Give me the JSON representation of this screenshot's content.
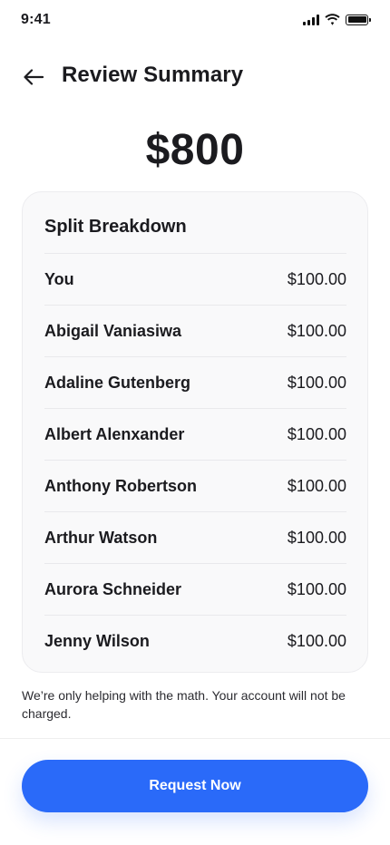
{
  "status_bar": {
    "time": "9:41"
  },
  "header": {
    "title": "Review Summary"
  },
  "total_amount": "$800",
  "breakdown": {
    "title": "Split Breakdown",
    "rows": [
      {
        "name": "You",
        "amount": "$100.00"
      },
      {
        "name": "Abigail Vaniasiwa",
        "amount": "$100.00"
      },
      {
        "name": "Adaline Gutenberg",
        "amount": "$100.00"
      },
      {
        "name": "Albert Alenxander",
        "amount": "$100.00"
      },
      {
        "name": "Anthony Robertson",
        "amount": "$100.00"
      },
      {
        "name": "Arthur Watson",
        "amount": "$100.00"
      },
      {
        "name": "Aurora Schneider",
        "amount": "$100.00"
      },
      {
        "name": "Jenny Wilson",
        "amount": "$100.00"
      }
    ]
  },
  "note": "We’re only helping with the math. Your account will not be charged.",
  "cta": {
    "label": "Request Now"
  },
  "colors": {
    "accent": "#2a6af9",
    "text": "#1b1b1f",
    "card_bg": "#f9f9fa"
  },
  "icons": {
    "back": "arrow-left-icon",
    "signal": "signal-icon",
    "wifi": "wifi-icon",
    "battery": "battery-icon"
  }
}
